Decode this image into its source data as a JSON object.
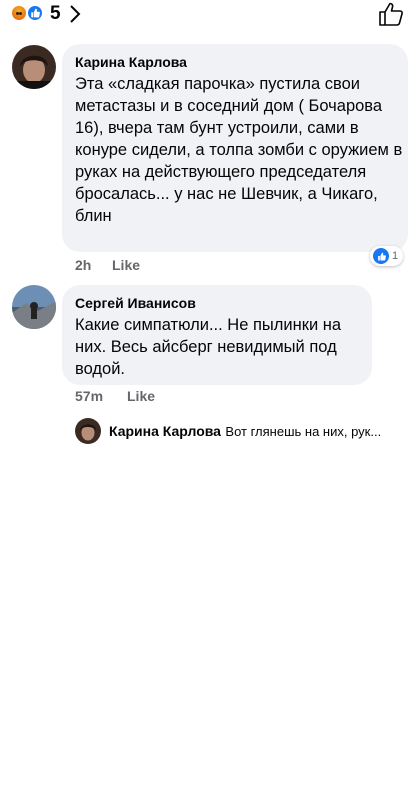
{
  "reactions": {
    "types": [
      "angry-reaction-icon",
      "like-reaction-icon"
    ],
    "count": "5"
  },
  "colors": {
    "bubble": "#f0f2f5",
    "meta": "#65676b",
    "accent": "#1877f2"
  },
  "comments": [
    {
      "author": "Карина Карлова",
      "text": "Эта «сладкая парочка» пустила свои метастазы и в соседний дом ( Бочарова 16), вчера там бунт устроили, сами в конуре сидели, а толпа зомби с оружием в руках на действующего председателя бросалась... у нас не Шевчик, а Чикаго, блин",
      "time": "2h",
      "like_label": "Like",
      "reaction_count": "1"
    },
    {
      "author": "Сергей Иванисов",
      "text": "Какие симпатюли... Не пылинки на них. Весь айсберг невидимый под водой.",
      "time": "57m",
      "like_label": "Like"
    }
  ],
  "reply_preview": {
    "author": "Карина Карлова",
    "text": "Вот глянешь на них, рук..."
  }
}
